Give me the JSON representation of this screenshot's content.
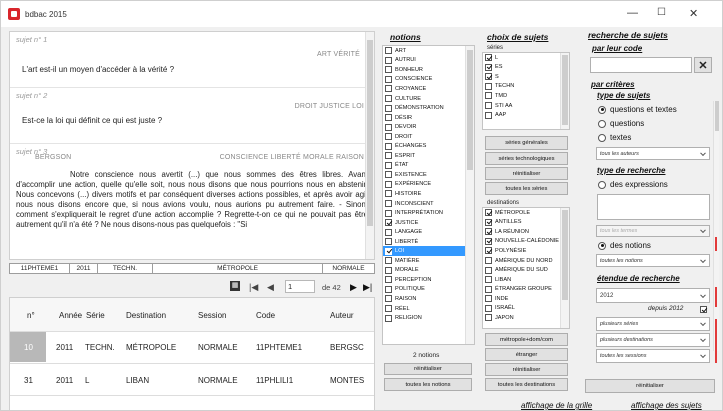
{
  "window": {
    "title": "bdbac 2015",
    "minimize": "—",
    "maximize": "☐",
    "close": "✕"
  },
  "subjects": [
    {
      "num": "sujet n° 1",
      "tags": "ART VÉRITÉ",
      "text": "L'art est-il un moyen d'accéder à la vérité ?"
    },
    {
      "num": "sujet n° 2",
      "tags": "DROIT JUSTICE LOI",
      "text": "Est-ce la loi qui définit ce qui est juste ?"
    },
    {
      "num": "sujet n° 3",
      "author": "BERGSON",
      "tags": "CONSCIENCE LIBERTÉ MORALE RAISON",
      "text": "Notre conscience nous avertit (...) que nous sommes des êtres libres. Avant d'accomplir une action, quelle qu'elle soit, nous nous disons que nous pourrions nous en abstenir. Nous concevons (...) divers motifs et par conséquent diverses actions possibles, et après avoir agi, nous nous disons encore que, si nous avions voulu, nous aurions pu autrement faire. - Sinon, comment s'expliquerait le regret d'une action accomplie ? Regrette-t-on ce qui ne pouvait pas être autrement qu'il n'a été ? Ne nous disons-nous pas quelquefois : \"Si"
    }
  ],
  "infobar": [
    "11PHTEME1",
    "2011",
    "TECHN.",
    "MÉTROPOLE",
    "NORMALE"
  ],
  "nav": {
    "current": "1",
    "total": "de 42"
  },
  "table": {
    "headers": [
      "n°",
      "Année",
      "Série",
      "Destination",
      "Session",
      "Code",
      "Auteur"
    ],
    "rows": [
      [
        "10",
        "2011",
        "TECHN.",
        "MÉTROPOLE",
        "NORMALE",
        "11PHTEME1",
        "BERGSC"
      ],
      [
        "31",
        "2011",
        "L",
        "LIBAN",
        "NORMALE",
        "11PHLILI1",
        "MONTES"
      ]
    ]
  },
  "notions": {
    "title": "notions",
    "items": [
      {
        "label": "ART",
        "checked": false
      },
      {
        "label": "AUTRUI",
        "checked": false
      },
      {
        "label": "BONHEUR",
        "checked": false
      },
      {
        "label": "CONSCIENCE",
        "checked": false
      },
      {
        "label": "CROYANCE",
        "checked": false
      },
      {
        "label": "CULTURE",
        "checked": false
      },
      {
        "label": "DÉMONSTRATION",
        "checked": false
      },
      {
        "label": "DÉSIR",
        "checked": false
      },
      {
        "label": "DEVOIR",
        "checked": false
      },
      {
        "label": "DROIT",
        "checked": false
      },
      {
        "label": "ÉCHANGES",
        "checked": false
      },
      {
        "label": "ESPRIT",
        "checked": false
      },
      {
        "label": "ÉTAT",
        "checked": false
      },
      {
        "label": "EXISTENCE",
        "checked": false
      },
      {
        "label": "EXPÉRIENCE",
        "checked": false
      },
      {
        "label": "HISTOIRE",
        "checked": false
      },
      {
        "label": "INCONSCIENT",
        "checked": false
      },
      {
        "label": "INTERPRÉTATION",
        "checked": false
      },
      {
        "label": "JUSTICE",
        "checked": true
      },
      {
        "label": "LANGAGE",
        "checked": false
      },
      {
        "label": "LIBERTÉ",
        "checked": false
      },
      {
        "label": "LOI",
        "checked": true,
        "selected": true
      },
      {
        "label": "MATIÈRE",
        "checked": false
      },
      {
        "label": "MORALE",
        "checked": false
      },
      {
        "label": "PERCEPTION",
        "checked": false
      },
      {
        "label": "POLITIQUE",
        "checked": false
      },
      {
        "label": "RAISON",
        "checked": false
      },
      {
        "label": "RÉEL",
        "checked": false
      },
      {
        "label": "RELIGION",
        "checked": false
      }
    ],
    "count": "2 notions",
    "reset": "réinitialiser",
    "all": "toutes les notions"
  },
  "choix": {
    "title": "choix de sujets",
    "series_label": "séries",
    "series": [
      {
        "label": "L",
        "checked": true
      },
      {
        "label": "ES",
        "checked": true
      },
      {
        "label": "S",
        "checked": true
      },
      {
        "label": "TECHN",
        "checked": false
      },
      {
        "label": "TMD",
        "checked": false
      },
      {
        "label": "STI AA",
        "checked": false
      },
      {
        "label": "AAP",
        "checked": false
      }
    ],
    "btn_generales": "séries générales",
    "btn_techno": "séries technologiques",
    "btn_reset": "réinitialiser",
    "btn_all": "toutes les séries",
    "dest_label": "destinations",
    "destinations": [
      {
        "label": "MÉTROPOLE",
        "checked": true
      },
      {
        "label": "ANTILLES",
        "checked": true
      },
      {
        "label": "LA RÉUNION",
        "checked": true
      },
      {
        "label": "NOUVELLE-CALÉDONIE",
        "checked": true
      },
      {
        "label": "POLYNÉSIE",
        "checked": true
      },
      {
        "label": "AMÉRIQUE DU NORD",
        "checked": false
      },
      {
        "label": "AMÉRIQUE DU SUD",
        "checked": false
      },
      {
        "label": "LIBAN",
        "checked": false
      },
      {
        "label": "ÉTRANGER GROUPE",
        "checked": false
      },
      {
        "label": "INDE",
        "checked": false
      },
      {
        "label": "ISRAËL",
        "checked": false
      },
      {
        "label": "JAPON",
        "checked": false
      }
    ],
    "btn_metro": "métropole+dom/com",
    "btn_etranger": "étranger",
    "btn_reset2": "réinitialiser",
    "btn_alldest": "toutes les destinations"
  },
  "recherche": {
    "title": "recherche de sujets",
    "by_code": "par leur code",
    "by_criteria": "par critères",
    "type_sujets": "type de sujets",
    "opt_both": "questions et textes",
    "opt_questions": "questions",
    "opt_textes": "textes",
    "authors_dd": "tous les auteurs",
    "type_recherche": "type de recherche",
    "opt_expr": "des expressions",
    "terms_dd": "tous les termes",
    "opt_notions": "des notions",
    "notions_dd": "toutes les notions",
    "etendue": "étendue de recherche",
    "year": "2012",
    "since_label": "depuis 2012",
    "dd_series": "plusieurs séries",
    "dd_dest": "plusieurs destinations",
    "dd_sessions": "toutes les sessions",
    "btn_reset": "réinitialiser"
  },
  "bottom": {
    "link1": "affichage de la grille",
    "link2": "affichage des sujets"
  }
}
